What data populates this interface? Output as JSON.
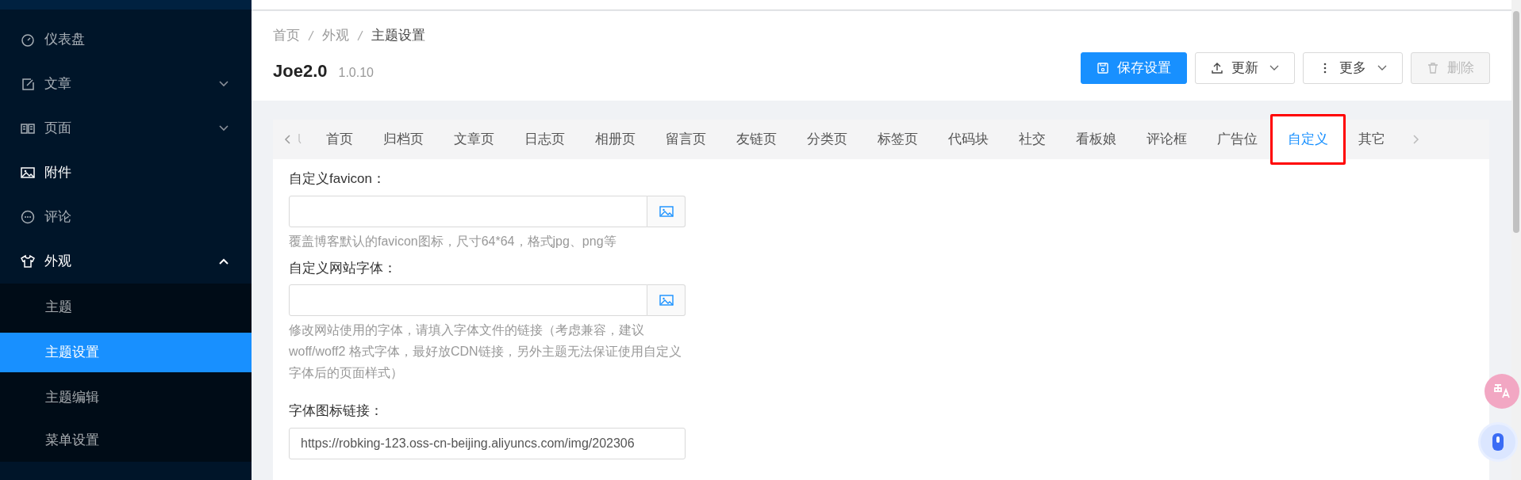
{
  "sidebar": {
    "items": [
      {
        "label": "仪表盘",
        "highlighted": false
      },
      {
        "label": "文章",
        "highlighted": false,
        "expanded": false
      },
      {
        "label": "页面",
        "highlighted": false,
        "expanded": false
      },
      {
        "label": "附件",
        "highlighted": true
      },
      {
        "label": "评论",
        "highlighted": false
      },
      {
        "label": "外观",
        "highlighted": true,
        "expanded": true,
        "children": [
          {
            "label": "主题",
            "selected": false
          },
          {
            "label": "主题设置",
            "selected": true
          },
          {
            "label": "主题编辑",
            "selected": false
          },
          {
            "label": "菜单设置",
            "selected": false
          }
        ]
      }
    ]
  },
  "breadcrumb": [
    "首页",
    "外观",
    "主题设置"
  ],
  "title": "Joe2.0",
  "version": "1.0.10",
  "actions": [
    {
      "label": "保存设置",
      "kind": "primary",
      "disabled": false
    },
    {
      "label": "更新",
      "kind": "default",
      "disabled": false,
      "dropdown": true
    },
    {
      "label": "更多",
      "kind": "default",
      "disabled": false,
      "dropdown": true
    },
    {
      "label": "删除",
      "kind": "default",
      "disabled": true
    }
  ],
  "tabs": [
    {
      "label": "首页",
      "selected": false,
      "highlighted": false
    },
    {
      "label": "归档页",
      "selected": false,
      "highlighted": false
    },
    {
      "label": "文章页",
      "selected": false,
      "highlighted": false
    },
    {
      "label": "日志页",
      "selected": false,
      "highlighted": false
    },
    {
      "label": "相册页",
      "selected": false,
      "highlighted": false
    },
    {
      "label": "留言页",
      "selected": false,
      "highlighted": false
    },
    {
      "label": "友链页",
      "selected": false,
      "highlighted": false
    },
    {
      "label": "分类页",
      "selected": false,
      "highlighted": false
    },
    {
      "label": "标签页",
      "selected": false,
      "highlighted": false
    },
    {
      "label": "代码块",
      "selected": false,
      "highlighted": false
    },
    {
      "label": "社交",
      "selected": false,
      "highlighted": false
    },
    {
      "label": "看板娘",
      "selected": false,
      "highlighted": false
    },
    {
      "label": "评论框",
      "selected": false,
      "highlighted": false
    },
    {
      "label": "广告位",
      "selected": false,
      "highlighted": false
    },
    {
      "label": "自定义",
      "selected": true,
      "highlighted": true
    },
    {
      "label": "其它",
      "selected": false,
      "highlighted": false
    }
  ],
  "fields": [
    {
      "label": "自定义favicon：",
      "picker": true,
      "help": "覆盖博客默认的favicon图标，尺寸64*64，格式jpg、png等"
    },
    {
      "label": "自定义网站字体：",
      "picker": true,
      "help": "修改网站使用的字体，请填入字体文件的链接（考虑兼容，建议woff/woff2 格式字体，最好放CDN链接，另外主题无法保证使用自定义字体后的页面样式）"
    },
    {
      "label": "字体图标链接：",
      "value": "https://robking-123.oss-cn-beijing.aliyuncs.com/img/202306",
      "picker": false
    }
  ]
}
